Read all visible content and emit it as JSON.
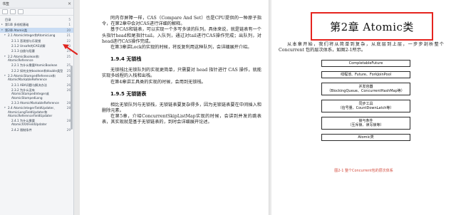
{
  "sidebar": {
    "header_title": "书签",
    "close_glyph": "✕",
    "items": [
      {
        "level": 0,
        "twisty": "",
        "label": "目录",
        "page": "5",
        "active": false
      },
      {
        "level": 0,
        "twisty": "▸",
        "label": "第1章 多线程基础",
        "page": "1",
        "active": false
      },
      {
        "level": 0,
        "twisty": "▾",
        "label": "第2章 Atomic类",
        "page": "20",
        "active": true
      },
      {
        "level": 1,
        "twisty": "▾",
        "label": "2.1 AtomicInteger和AtomicLong",
        "page": "21",
        "active": false
      },
      {
        "level": 2,
        "twisty": "",
        "label": "2.1.1 悲观锁与乐观锁",
        "page": "22",
        "active": false
      },
      {
        "level": 2,
        "twisty": "",
        "label": "2.1.2 Unsafe的CAS详解",
        "page": "23",
        "active": false
      },
      {
        "level": 2,
        "twisty": "",
        "label": "2.1.3 自旋与阻塞",
        "page": "24",
        "active": false
      },
      {
        "level": 1,
        "twisty": "▾",
        "label": "2.2 AtomicBoolean和AtomicReference",
        "page": "25",
        "active": false
      },
      {
        "level": 2,
        "twisty": "",
        "label": "2.2.1 为什么需要AtomicBoolean",
        "page": "25",
        "active": false
      },
      {
        "level": 2,
        "twisty": "",
        "label": "2.2.2 如何支持boolean和double类型",
        "page": "25",
        "active": false
      },
      {
        "level": 1,
        "twisty": "▾",
        "label": "2.3 AtomicStampedReference和AtomicMarkableReference",
        "page": "26",
        "active": false
      },
      {
        "level": 2,
        "twisty": "",
        "label": "2.3.1 ABA问题与解决办法",
        "page": "26",
        "active": false
      },
      {
        "level": 2,
        "twisty": "",
        "label": "2.3.2 为什么没有AtomicStampedInteger或AtomicStampedLong",
        "page": "26",
        "active": false
      },
      {
        "level": 2,
        "twisty": "",
        "label": "2.3.3 AtomicMarkableReference",
        "page": "28",
        "active": false
      },
      {
        "level": 1,
        "twisty": "▾",
        "label": "2.4 AtomicIntegerFieldUpdater、AtomicLongFieldUpdater和AtomicReferenceFieldUpdater",
        "page": "28",
        "active": false
      },
      {
        "level": 2,
        "twisty": "",
        "label": "2.4.1 为什么需要AtomicXXXFieldUpdater",
        "page": "28",
        "active": false
      },
      {
        "level": 2,
        "twisty": "",
        "label": "2.4.2 限制条件",
        "page": "29",
        "active": false
      }
    ]
  },
  "left_page": {
    "blocks": [
      {
        "type": "p",
        "text": "同内存屏障一样，CAS（Compare And Set）也是CPU提供的一种原子指令，在第2章中会对CAS进行详细的解释。"
      },
      {
        "type": "p",
        "text": "基于CAS和链表，可以实现一个多写多读的队列。具体来说，就是链表有一个头指针head和尾指针tail。入队列，通过对tail进行CAS操作完成；出队列，对head进行CAS操作完成。"
      },
      {
        "type": "p",
        "text": "在第3章讲Lock的实现的时候，将反复利用这种队列，会详细展开介绍。"
      },
      {
        "type": "h",
        "text": "1.9.4 无锁栈"
      },
      {
        "type": "p",
        "text": "无锁栈比无锁队列的实现更简单，只需要对 head 指针进行 CAS 操作，就能实现多线程的入栈和出栈。"
      },
      {
        "type": "p",
        "text": "在第4章讲工具类的实现的时候，会用到无锁栈。"
      },
      {
        "type": "h",
        "text": "1.9.5 无锁链表"
      },
      {
        "type": "p",
        "text": "相比无锁队列与无锁栈，无锁链表要复杂得多，因为无锁链表要在中间插入和删除元素。"
      },
      {
        "type": "p",
        "text": "在第5章，介绍ConcurrentSkipListMap实现的时候，会讲到并发的跳表表，其实现就是基于无锁链表的，到时会详细展开论述。"
      }
    ]
  },
  "right_page": {
    "chapter_title": "第2章 Atomic类",
    "intro": "从本章开始，我们将从简单到复杂，从底层到上层，一步步剖析整个 Concurrent 包的层次体系，如图2-1所示。",
    "diagram": [
      {
        "lines": [
          "CompletableFuture"
        ]
      },
      {
        "lines": [
          "线程池、Future、ForkJoinPool"
        ]
      },
      {
        "lines": [
          "并发容器",
          "（BlockingQueue、ConcurrentHashMap等）"
        ]
      },
      {
        "lines": [
          "同步工具",
          "（信号量、CountDownLatch等）"
        ]
      },
      {
        "lines": [
          "锁与条件",
          "（互斥锁、读写锁等）"
        ]
      },
      {
        "lines": [
          "Atomic类"
        ]
      }
    ],
    "caption": "图2-1  整个Concurrent包的层次体系"
  },
  "colors": {
    "highlight_border": "#e5241f",
    "arrow": "#e0251f",
    "caption": "#d34a3c",
    "active_item": "#c9dcf3"
  }
}
